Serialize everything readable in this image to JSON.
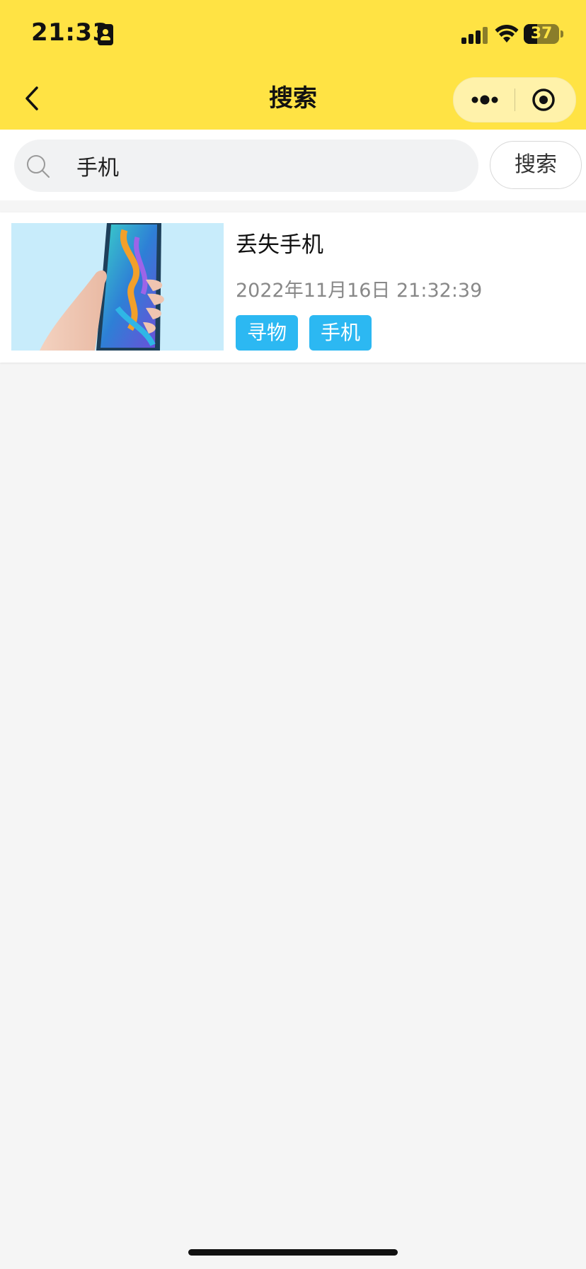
{
  "status_bar": {
    "time": "21:33",
    "battery_level": "37",
    "battery_fraction": 0.37,
    "icons": [
      "contact-card-icon",
      "signal-icon",
      "wifi-icon",
      "battery-icon"
    ]
  },
  "nav": {
    "title": "搜索",
    "back_icon": "chevron-left-icon",
    "menu_icon": "more-dots-icon",
    "close_icon": "target-circle-icon"
  },
  "search": {
    "query": "手机",
    "button_label": "搜索",
    "icon": "search-icon"
  },
  "results": [
    {
      "title": "丢失手机",
      "time": "2022年11月16日 21:32:39",
      "tags": [
        "寻物",
        "手机"
      ],
      "image": "phone-in-hand-photo"
    }
  ],
  "colors": {
    "accent_yellow": "#ffe344",
    "tag_blue": "#2cb8f2",
    "page_bg": "#f5f5f5"
  }
}
